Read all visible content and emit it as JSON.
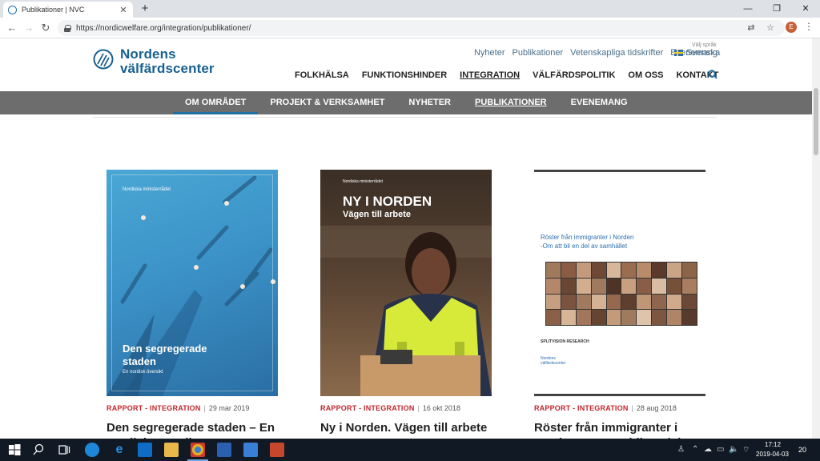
{
  "browser": {
    "tab_title": "Publikationer | NVC",
    "tab_close": "✕",
    "new_tab": "+",
    "url": "https://nordicwelfare.org/integration/publikationer/",
    "profile_initial": "E",
    "window_controls": [
      "—",
      "❐",
      "✕"
    ]
  },
  "site": {
    "logo_line1": "Nordens",
    "logo_line2": "välfärdscenter",
    "top_links": [
      "Nyheter",
      "Publikationer",
      "Vetenskapliga tidskrifter",
      "Evenemang"
    ],
    "language_label": "Välj språk",
    "language": "Svenska",
    "main_nav": [
      "FOLKHÄLSA",
      "FUNKTIONSHINDER",
      "INTEGRATION",
      "VÄLFÄRDSPOLITIK",
      "OM OSS",
      "KONTAKT"
    ],
    "main_nav_active": "INTEGRATION",
    "sub_nav": [
      "OM OMRÅDET",
      "PROJEKT & VERKSAMHET",
      "NYHETER",
      "PUBLIKATIONER",
      "EVENEMANG"
    ],
    "sub_nav_active": "PUBLIKATIONER",
    "colors": {
      "brand_blue": "#17608f",
      "category_red": "#c0262c",
      "subnav_gray": "#6d6d6d",
      "current_underline": "#1f6ea4"
    }
  },
  "publications": [
    {
      "cover_org": "Nordiska ministerrådet",
      "cover_title_line1": "Den segregerade",
      "cover_title_line2": "staden",
      "cover_subtitle": "En nordisk översikt",
      "category": "RAPPORT - INTEGRATION",
      "date": "29 mar 2019",
      "title": "Den segregerade staden – En nordisk översikt"
    },
    {
      "cover_org": "Nordiska ministerrådet",
      "cover_title": "NY I NORDEN",
      "cover_subtitle": "Vägen till arbete",
      "category": "RAPPORT - INTEGRATION",
      "date": "16 okt 2018",
      "title": "Ny i Norden. Vägen till arbete"
    },
    {
      "cover_title_line1": "Röster från immigranter i Norden",
      "cover_title_line2": "-Om att bli en del av samhället",
      "cover_brand": "SPLITVISION RESEARCH",
      "cover_logo_line1": "Nordens",
      "cover_logo_line2": "välfärdscenter",
      "category": "RAPPORT - INTEGRATION",
      "date": "28 aug 2018",
      "title": "Röster från immigranter i Norden – om att bli en del av samhället"
    }
  ],
  "taskbar": {
    "time": "17:12",
    "date": "2019-04-03",
    "notifications": "20"
  }
}
